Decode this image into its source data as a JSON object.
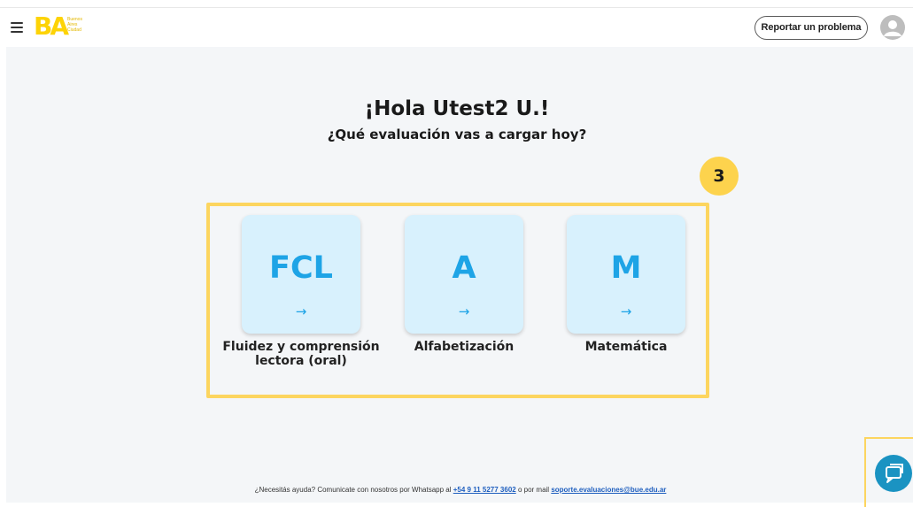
{
  "header": {
    "logo_text": "BA",
    "logo_sub": [
      "Buenos",
      "Aires",
      "Ciudad"
    ],
    "report_button": "Reportar un problema"
  },
  "main": {
    "greeting": "¡Hola Utest2 U.!",
    "subtitle": "¿Qué evaluación vas a cargar hoy?",
    "step_badge": "3",
    "cards": [
      {
        "abbr": "FCL",
        "arrow": "→",
        "label": "Fluidez y comprensión lectora (oral)"
      },
      {
        "abbr": "A",
        "arrow": "→",
        "label": "Alfabetización"
      },
      {
        "abbr": "M",
        "arrow": "→",
        "label": "Matemática"
      }
    ]
  },
  "footer": {
    "text_before": "¿Necesitás ayuda? Comunicate con nosotros por Whatsapp al",
    "phone": "+54 9 11 5277 3602",
    "text_middle": "o por mail",
    "email": "soporte.evaluaciones@bue.edu.ar"
  },
  "colors": {
    "brand_yellow": "#fdd306",
    "card_bg": "#d8f1fd",
    "card_accent": "#1ea4e6",
    "highlight": "#fcd55f",
    "chat_button": "#1a93c2"
  },
  "icons": {
    "menu": "hamburger-icon",
    "avatar": "user-avatar-icon",
    "chat": "chat-icon"
  }
}
